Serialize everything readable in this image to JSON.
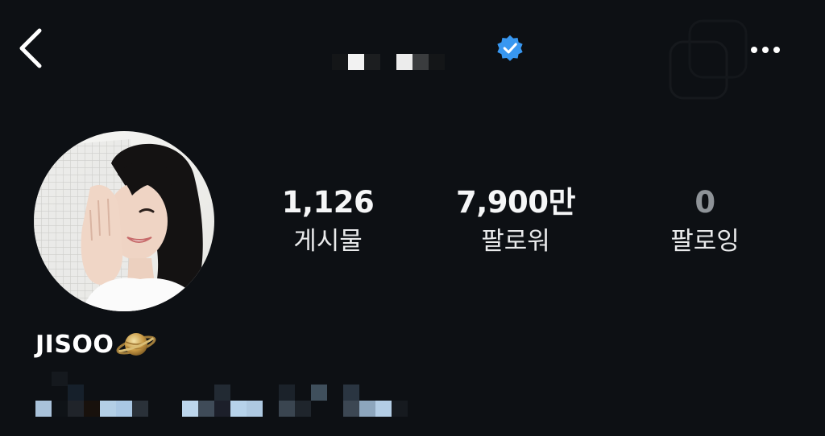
{
  "header": {
    "back_icon": "chevron-left-icon",
    "verified_icon": "verified-badge-icon",
    "verified_color": "#3897f0",
    "more_icon": "more-horizontal-icon"
  },
  "profile": {
    "display_name": "JISOO",
    "name_emoji_icon": "ringed-planet-icon"
  },
  "stats": [
    {
      "value": "1,126",
      "label": "게시물"
    },
    {
      "value": "7,900만",
      "label": "팔로워"
    },
    {
      "value": "0",
      "label": "팔로잉"
    }
  ],
  "colors": {
    "background": "#0d1014",
    "text": "#ffffff",
    "muted_number": "#8e9398"
  }
}
